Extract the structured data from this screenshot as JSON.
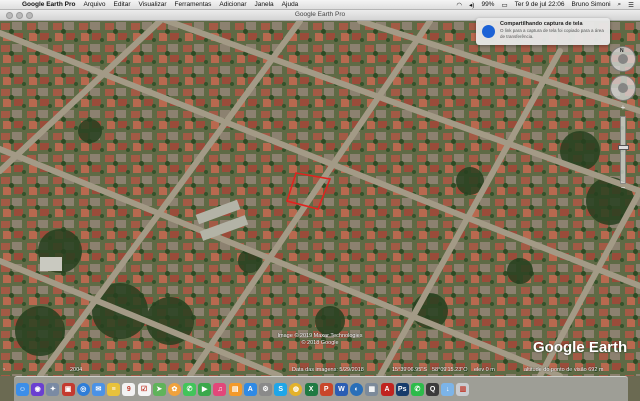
{
  "menubar": {
    "app": "Google Earth Pro",
    "items": [
      "Arquivo",
      "Editar",
      "Visualizar",
      "Ferramentas",
      "Adicionar",
      "Janela",
      "Ajuda"
    ],
    "battery": "99%",
    "clock": "Ter 9 de jul  22:06",
    "user": "Bruno Simoni"
  },
  "window": {
    "title": "Google Earth Pro"
  },
  "notification": {
    "title": "Compartilhando captura de tela",
    "body": "O link para a captura de tela foi copiado para a área de transferência."
  },
  "navigation": {
    "north": "N"
  },
  "map": {
    "copyright_line1": "Image © 2019 Maxar Technologies",
    "copyright_line2": "© 2018 Google",
    "logo": "Google Earth",
    "highlight_color": "#e0231f"
  },
  "status": {
    "year": "2004",
    "imagery_date": "Data das imagens: 5/29/2018",
    "lat": "15°39'06.95\"S",
    "lon": "58°09'15.23\"O",
    "elev": "elev  0 m",
    "eye": "altitude do ponto de visão   692 m"
  },
  "dock": {
    "apps": [
      {
        "name": "finder-icon",
        "color": "#3c8ee8",
        "glyph": "☺"
      },
      {
        "name": "siri-icon",
        "color": "#6a3fd1",
        "glyph": "◉"
      },
      {
        "name": "launchpad-icon",
        "color": "#7a8aa3",
        "glyph": "✦"
      },
      {
        "name": "photo-booth-icon",
        "color": "#c43a2f",
        "glyph": "▣"
      },
      {
        "name": "safari-icon",
        "color": "#2e7dd8",
        "glyph": "◎"
      },
      {
        "name": "mail-icon",
        "color": "#4b92e6",
        "glyph": "✉"
      },
      {
        "name": "notes-icon",
        "color": "#e8c23b",
        "glyph": "≡"
      },
      {
        "name": "calendar-icon",
        "color": "#f2f2f2",
        "glyph": "9"
      },
      {
        "name": "reminders-icon",
        "color": "#f5f5f5",
        "glyph": "☑"
      },
      {
        "name": "maps-icon",
        "color": "#5fb35a",
        "glyph": "➤"
      },
      {
        "name": "photos-icon",
        "color": "#f0a23c",
        "glyph": "✿"
      },
      {
        "name": "messages-icon",
        "color": "#42c45a",
        "glyph": "✆"
      },
      {
        "name": "facetime-icon",
        "color": "#3aa84b",
        "glyph": "▶"
      },
      {
        "name": "itunes-icon",
        "color": "#e2477a",
        "glyph": "♫"
      },
      {
        "name": "ibooks-icon",
        "color": "#f39a2b",
        "glyph": "▤"
      },
      {
        "name": "app-store-icon",
        "color": "#2f8ae5",
        "glyph": "A"
      },
      {
        "name": "system-preferences-icon",
        "color": "#8a8a8a",
        "glyph": "⚙"
      },
      {
        "name": "skype-icon",
        "color": "#1fa6e8",
        "glyph": "S"
      },
      {
        "name": "chrome-icon",
        "color": "#e3b22a",
        "glyph": "◍"
      },
      {
        "name": "excel-icon",
        "color": "#1f7a43",
        "glyph": "X"
      },
      {
        "name": "powerpoint-icon",
        "color": "#c9462a",
        "glyph": "P"
      },
      {
        "name": "word-icon",
        "color": "#2b5db3",
        "glyph": "W"
      },
      {
        "name": "google-earth-icon",
        "color": "#2a6fb8",
        "glyph": "◐"
      },
      {
        "name": "preview-icon",
        "color": "#7c8a9a",
        "glyph": "▦"
      },
      {
        "name": "acrobat-icon",
        "color": "#c0231f",
        "glyph": "A"
      },
      {
        "name": "photoshop-icon",
        "color": "#173c6b",
        "glyph": "Ps"
      },
      {
        "name": "whatsapp-icon",
        "color": "#2dbb4a",
        "glyph": "✆"
      },
      {
        "name": "quicktime-icon",
        "color": "#3b3b3b",
        "glyph": "Q"
      },
      {
        "name": "downloads-folder-icon",
        "color": "#7cb4e8",
        "glyph": "↓"
      },
      {
        "name": "trash-icon",
        "color": "#c9ccd1",
        "glyph": "▥"
      }
    ]
  }
}
